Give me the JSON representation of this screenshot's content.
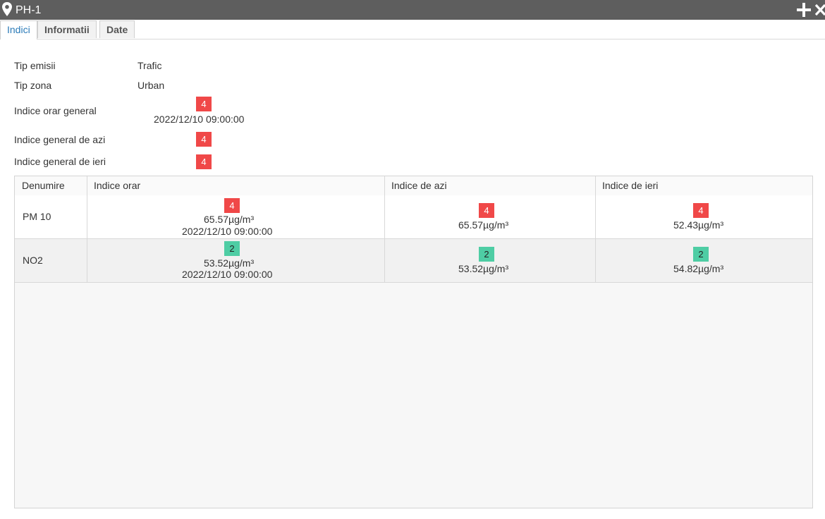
{
  "window": {
    "title": "PH-1",
    "icons": [
      "map-pin-icon",
      "plus-icon",
      "close-icon"
    ]
  },
  "tabs": [
    {
      "label": "Indici",
      "active": true
    },
    {
      "label": "Informatii",
      "active": false
    },
    {
      "label": "Date",
      "active": false
    }
  ],
  "info": {
    "tip_emisii": {
      "label": "Tip emisii",
      "value": "Trafic"
    },
    "tip_zona": {
      "label": "Tip zona",
      "value": "Urban"
    },
    "indice_orar_general": {
      "label": "Indice orar general",
      "index": "4",
      "timestamp": "2022/12/10 09:00:00"
    },
    "indice_azi": {
      "label": "Indice general de azi",
      "index": "4"
    },
    "indice_ieri": {
      "label": "Indice general de ieri",
      "index": "4"
    }
  },
  "table": {
    "headers": [
      "Denumire",
      "Indice orar",
      "Indice de azi",
      "Indice de ieri"
    ],
    "rows": [
      {
        "name": "PM 10",
        "orar": {
          "index": "4",
          "value": "65.57µg/m³",
          "timestamp": "2022/12/10 09:00:00"
        },
        "azi": {
          "index": "4",
          "value": "65.57µg/m³"
        },
        "ieri": {
          "index": "4",
          "value": "52.43µg/m³"
        }
      },
      {
        "name": "NO2",
        "orar": {
          "index": "2",
          "value": "53.52µg/m³",
          "timestamp": "2022/12/10 09:00:00"
        },
        "azi": {
          "index": "2",
          "value": "53.52µg/m³"
        },
        "ieri": {
          "index": "2",
          "value": "54.82µg/m³"
        }
      }
    ]
  },
  "colors": {
    "index_4": "#f04848",
    "index_2": "#4ecda4",
    "titlebar": "#5e5e5e",
    "active_tab": "#2a7ab8"
  }
}
